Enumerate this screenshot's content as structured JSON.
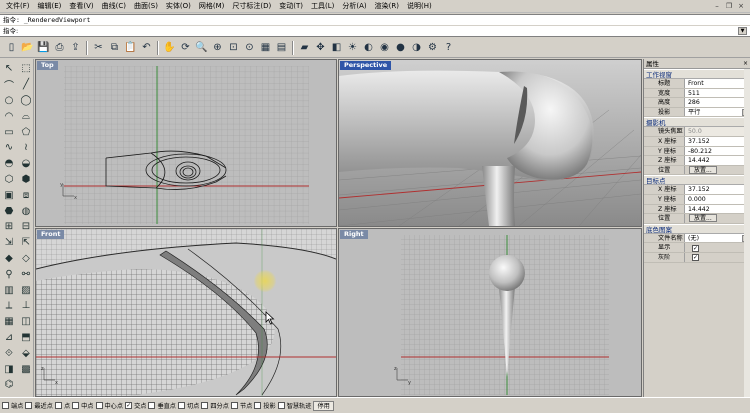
{
  "menu": [
    "文件(F)",
    "编辑(E)",
    "查看(V)",
    "曲线(C)",
    "曲面(S)",
    "实体(O)",
    "网格(M)",
    "尺寸标注(D)",
    "变动(T)",
    "工具(L)",
    "分析(A)",
    "渲染(R)",
    "说明(H)"
  ],
  "command": {
    "history": "指令: _RenderedViewport",
    "prompt": "指令:"
  },
  "toolbar_icons": [
    "new-icon",
    "open-icon",
    "save-icon",
    "print-icon",
    "import-icon",
    "cut-icon",
    "copy-icon",
    "paste-icon",
    "undo-icon",
    "pan-icon",
    "rotate-icon",
    "zoom-icon",
    "zoom-window-icon",
    "zoom-extents-icon",
    "zoom-selected-icon",
    "grid-icon",
    "layout-icon",
    "car-icon",
    "move-icon",
    "layer-icon",
    "light-icon",
    "material-icon",
    "render-icon",
    "sphere-icon",
    "shade-icon",
    "options-icon",
    "help-icon"
  ],
  "viewports": {
    "top": {
      "label": "Top"
    },
    "perspective": {
      "label": "Perspective"
    },
    "front": {
      "label": "Front"
    },
    "right": {
      "label": "Right"
    }
  },
  "properties": {
    "title": "属性",
    "close": "×",
    "viewport_section": "工作视窗",
    "viewport_rows": [
      {
        "key": "标题",
        "value": "Front"
      },
      {
        "key": "宽度",
        "value": "511"
      },
      {
        "key": "高度",
        "value": "286"
      },
      {
        "key": "投影",
        "value": "平行"
      }
    ],
    "camera_section": "摄影机",
    "camera_rows": [
      {
        "key": "镜头焦距",
        "value": "50.0"
      },
      {
        "key": "X 座标",
        "value": "37.152"
      },
      {
        "key": "Y 座标",
        "value": "-80.212"
      },
      {
        "key": "Z 座标",
        "value": "14.442"
      }
    ],
    "camera_position": {
      "key": "位置",
      "button": "放置..."
    },
    "target_section": "目标点",
    "target_rows": [
      {
        "key": "X 座标",
        "value": "37.152"
      },
      {
        "key": "Y 座标",
        "value": "0.000"
      },
      {
        "key": "Z 座标",
        "value": "14.442"
      }
    ],
    "target_position": {
      "key": "位置",
      "button": "放置..."
    },
    "bg_section": "底色图案",
    "bg_rows": [
      {
        "key": "文件名称",
        "value": "(无)"
      },
      {
        "key": "显示",
        "value": "✓"
      },
      {
        "key": "灰阶",
        "value": "✓"
      }
    ]
  },
  "osnap": [
    {
      "label": "端点",
      "checked": false
    },
    {
      "label": "最近点",
      "checked": false
    },
    {
      "label": "点",
      "checked": false
    },
    {
      "label": "中点",
      "checked": false
    },
    {
      "label": "中心点",
      "checked": false
    },
    {
      "label": "交点",
      "checked": true
    },
    {
      "label": "垂直点",
      "checked": false
    },
    {
      "label": "切点",
      "checked": false
    },
    {
      "label": "四分点",
      "checked": false
    },
    {
      "label": "节点",
      "checked": false
    },
    {
      "label": "投影",
      "checked": false
    },
    {
      "label": "智慧轨迹",
      "checked": false
    }
  ],
  "osnap_disable": "停用",
  "colors": {
    "active_label": "#2f55a8",
    "viewport_bg": "#bdbdbd",
    "grid": "#9a9a9a",
    "x_axis": "#b03030",
    "y_axis": "#2f8a2f"
  }
}
